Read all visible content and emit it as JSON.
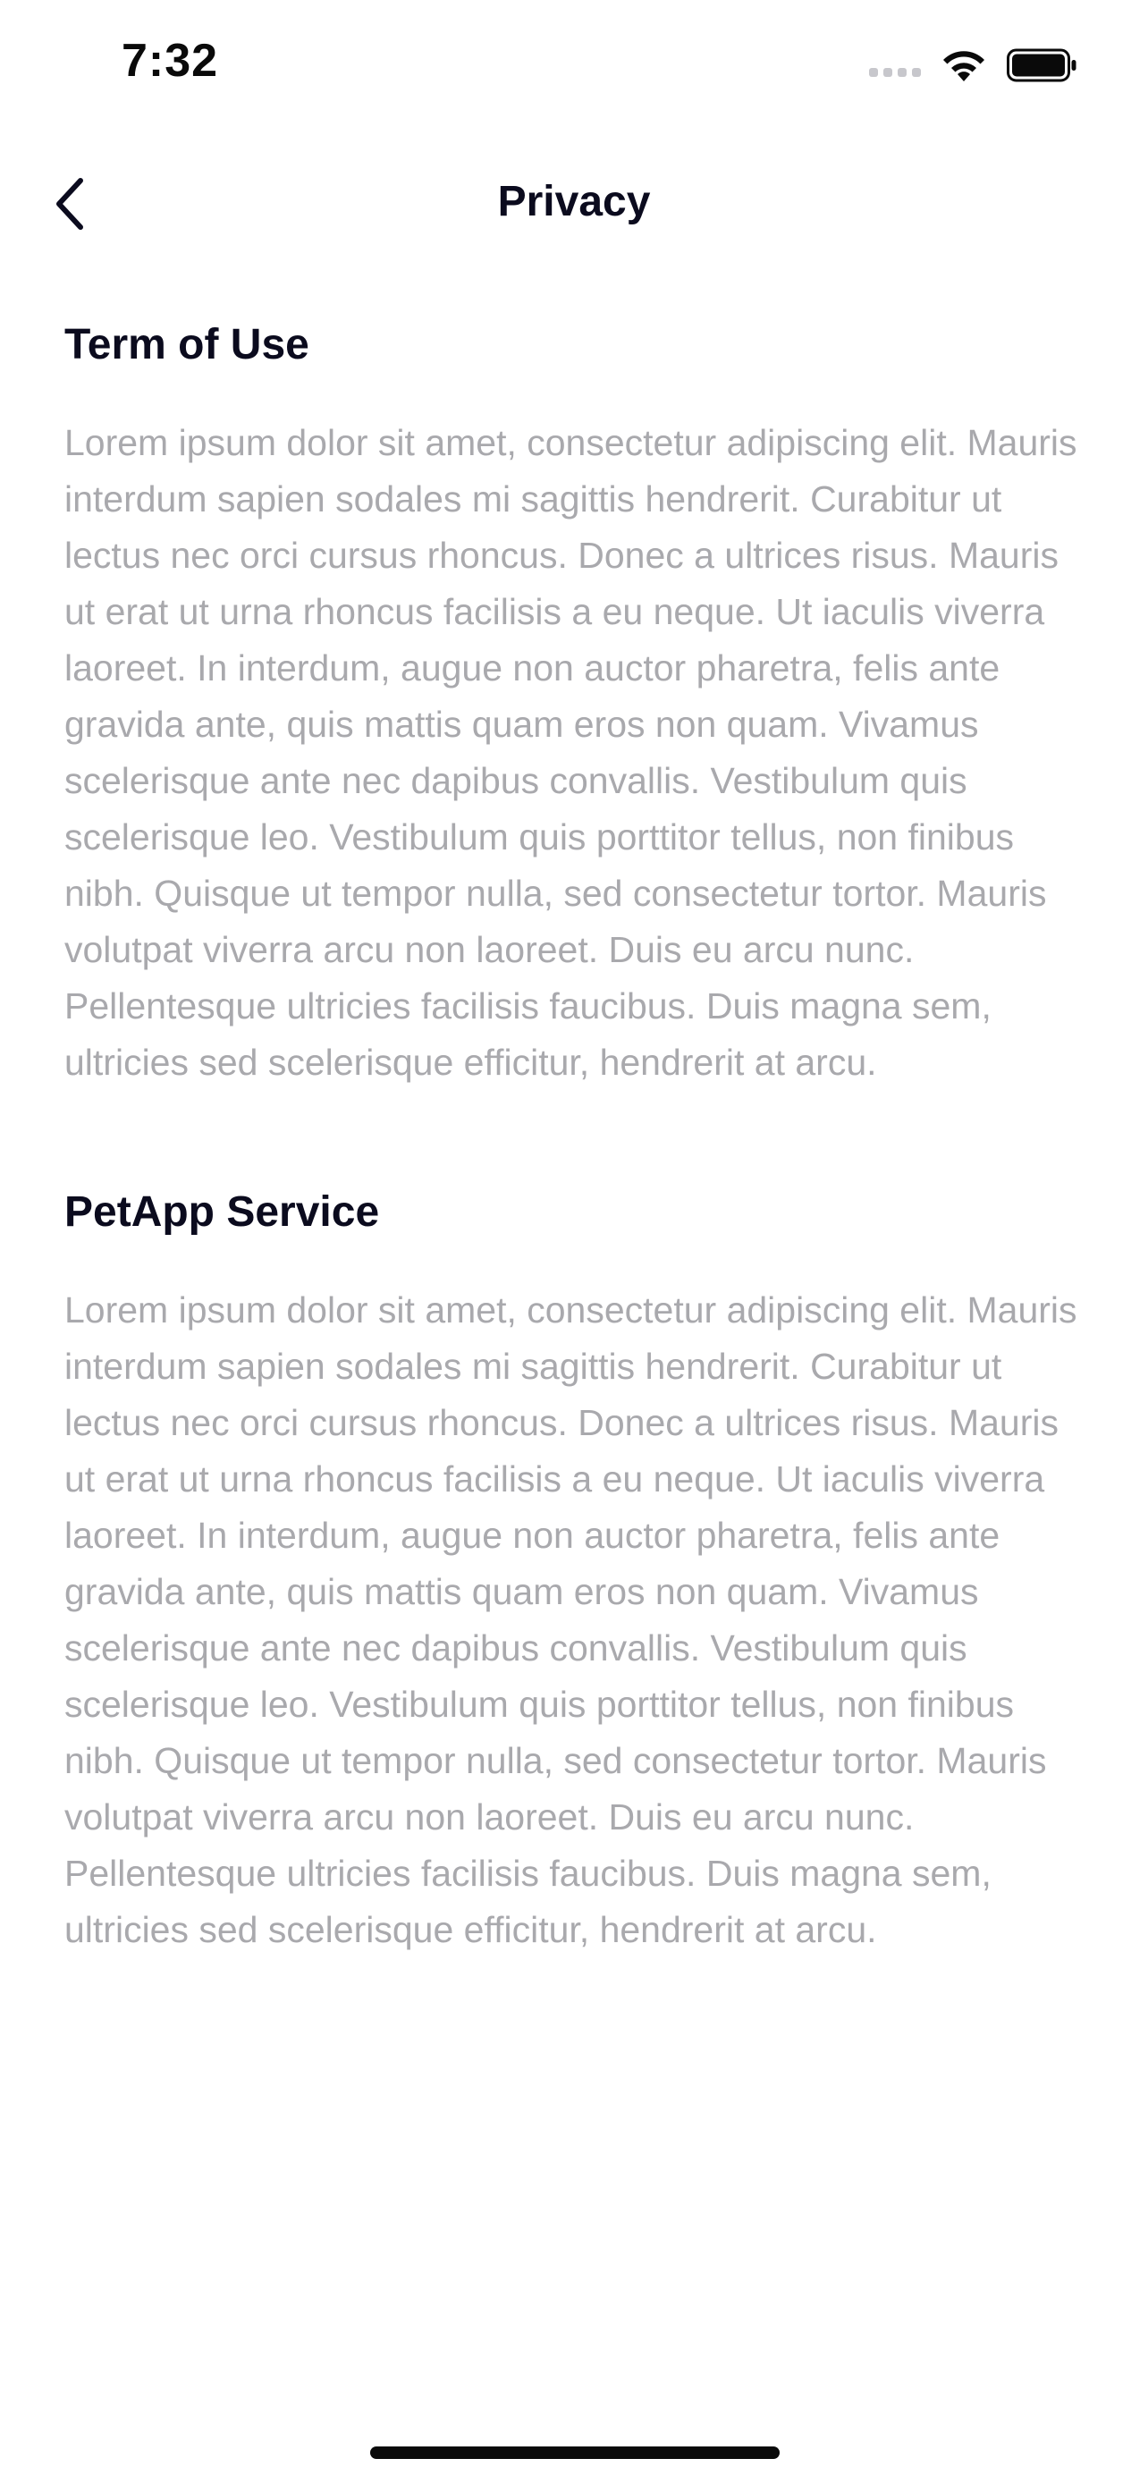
{
  "status_bar": {
    "time": "7:32",
    "icons": [
      "signal-icon",
      "wifi-icon",
      "battery-icon"
    ]
  },
  "nav": {
    "title": "Privacy",
    "back_icon": "chevron-left-icon"
  },
  "sections": [
    {
      "title": "Term of Use",
      "body": "Lorem ipsum dolor sit amet, consectetur adipiscing elit. Mauris interdum sapien sodales mi sagittis hendrerit. Curabitur ut lectus nec orci cursus rhoncus. Donec a ultrices risus. Mauris ut erat ut urna rhoncus facilisis a eu neque. Ut iaculis viverra laoreet. In interdum, augue non auctor pharetra, felis ante gravida ante, quis mattis quam eros non quam. Vivamus scelerisque ante nec dapibus convallis. Vestibulum quis scelerisque leo. Vestibulum quis porttitor tellus, non finibus nibh. Quisque ut tempor nulla, sed consectetur tortor. Mauris volutpat viverra arcu non laoreet. Duis eu arcu nunc. Pellentesque ultricies facilisis faucibus. Duis magna sem, ultricies sed scelerisque efficitur, hendrerit at arcu."
    },
    {
      "title": "PetApp Service",
      "body": "Lorem ipsum dolor sit amet, consectetur adipiscing elit. Mauris interdum sapien sodales mi sagittis hendrerit. Curabitur ut lectus nec orci cursus rhoncus. Donec a ultrices risus. Mauris ut erat ut urna rhoncus facilisis a eu neque. Ut iaculis viverra laoreet. In interdum, augue non auctor pharetra, felis ante gravida ante, quis mattis quam eros non quam. Vivamus scelerisque ante nec dapibus convallis. Vestibulum quis scelerisque leo. Vestibulum quis porttitor tellus, non finibus nibh. Quisque ut tempor nulla, sed consectetur tortor. Mauris volutpat viverra arcu non laoreet. Duis eu arcu nunc. Pellentesque ultricies facilisis faucibus. Duis magna sem, ultricies sed scelerisque efficitur, hendrerit at arcu."
    }
  ],
  "colors": {
    "heading": "#0b0b1e",
    "body_text": "#a9a9ad",
    "background": "#ffffff"
  }
}
